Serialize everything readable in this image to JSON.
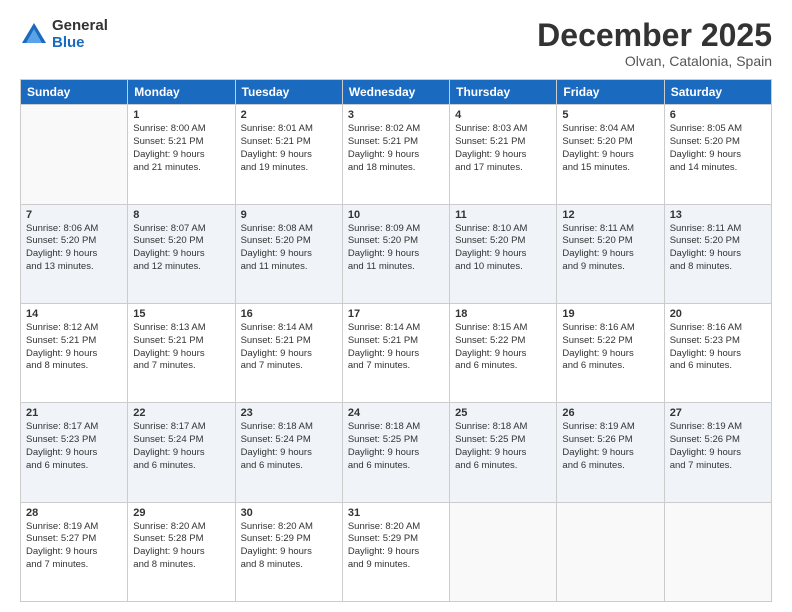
{
  "logo": {
    "general": "General",
    "blue": "Blue"
  },
  "title": "December 2025",
  "subtitle": "Olvan, Catalonia, Spain",
  "headers": [
    "Sunday",
    "Monday",
    "Tuesday",
    "Wednesday",
    "Thursday",
    "Friday",
    "Saturday"
  ],
  "weeks": [
    [
      {
        "day": "",
        "info": ""
      },
      {
        "day": "1",
        "info": "Sunrise: 8:00 AM\nSunset: 5:21 PM\nDaylight: 9 hours\nand 21 minutes."
      },
      {
        "day": "2",
        "info": "Sunrise: 8:01 AM\nSunset: 5:21 PM\nDaylight: 9 hours\nand 19 minutes."
      },
      {
        "day": "3",
        "info": "Sunrise: 8:02 AM\nSunset: 5:21 PM\nDaylight: 9 hours\nand 18 minutes."
      },
      {
        "day": "4",
        "info": "Sunrise: 8:03 AM\nSunset: 5:21 PM\nDaylight: 9 hours\nand 17 minutes."
      },
      {
        "day": "5",
        "info": "Sunrise: 8:04 AM\nSunset: 5:20 PM\nDaylight: 9 hours\nand 15 minutes."
      },
      {
        "day": "6",
        "info": "Sunrise: 8:05 AM\nSunset: 5:20 PM\nDaylight: 9 hours\nand 14 minutes."
      }
    ],
    [
      {
        "day": "7",
        "info": "Sunrise: 8:06 AM\nSunset: 5:20 PM\nDaylight: 9 hours\nand 13 minutes."
      },
      {
        "day": "8",
        "info": "Sunrise: 8:07 AM\nSunset: 5:20 PM\nDaylight: 9 hours\nand 12 minutes."
      },
      {
        "day": "9",
        "info": "Sunrise: 8:08 AM\nSunset: 5:20 PM\nDaylight: 9 hours\nand 11 minutes."
      },
      {
        "day": "10",
        "info": "Sunrise: 8:09 AM\nSunset: 5:20 PM\nDaylight: 9 hours\nand 11 minutes."
      },
      {
        "day": "11",
        "info": "Sunrise: 8:10 AM\nSunset: 5:20 PM\nDaylight: 9 hours\nand 10 minutes."
      },
      {
        "day": "12",
        "info": "Sunrise: 8:11 AM\nSunset: 5:20 PM\nDaylight: 9 hours\nand 9 minutes."
      },
      {
        "day": "13",
        "info": "Sunrise: 8:11 AM\nSunset: 5:20 PM\nDaylight: 9 hours\nand 8 minutes."
      }
    ],
    [
      {
        "day": "14",
        "info": "Sunrise: 8:12 AM\nSunset: 5:21 PM\nDaylight: 9 hours\nand 8 minutes."
      },
      {
        "day": "15",
        "info": "Sunrise: 8:13 AM\nSunset: 5:21 PM\nDaylight: 9 hours\nand 7 minutes."
      },
      {
        "day": "16",
        "info": "Sunrise: 8:14 AM\nSunset: 5:21 PM\nDaylight: 9 hours\nand 7 minutes."
      },
      {
        "day": "17",
        "info": "Sunrise: 8:14 AM\nSunset: 5:21 PM\nDaylight: 9 hours\nand 7 minutes."
      },
      {
        "day": "18",
        "info": "Sunrise: 8:15 AM\nSunset: 5:22 PM\nDaylight: 9 hours\nand 6 minutes."
      },
      {
        "day": "19",
        "info": "Sunrise: 8:16 AM\nSunset: 5:22 PM\nDaylight: 9 hours\nand 6 minutes."
      },
      {
        "day": "20",
        "info": "Sunrise: 8:16 AM\nSunset: 5:23 PM\nDaylight: 9 hours\nand 6 minutes."
      }
    ],
    [
      {
        "day": "21",
        "info": "Sunrise: 8:17 AM\nSunset: 5:23 PM\nDaylight: 9 hours\nand 6 minutes."
      },
      {
        "day": "22",
        "info": "Sunrise: 8:17 AM\nSunset: 5:24 PM\nDaylight: 9 hours\nand 6 minutes."
      },
      {
        "day": "23",
        "info": "Sunrise: 8:18 AM\nSunset: 5:24 PM\nDaylight: 9 hours\nand 6 minutes."
      },
      {
        "day": "24",
        "info": "Sunrise: 8:18 AM\nSunset: 5:25 PM\nDaylight: 9 hours\nand 6 minutes."
      },
      {
        "day": "25",
        "info": "Sunrise: 8:18 AM\nSunset: 5:25 PM\nDaylight: 9 hours\nand 6 minutes."
      },
      {
        "day": "26",
        "info": "Sunrise: 8:19 AM\nSunset: 5:26 PM\nDaylight: 9 hours\nand 6 minutes."
      },
      {
        "day": "27",
        "info": "Sunrise: 8:19 AM\nSunset: 5:26 PM\nDaylight: 9 hours\nand 7 minutes."
      }
    ],
    [
      {
        "day": "28",
        "info": "Sunrise: 8:19 AM\nSunset: 5:27 PM\nDaylight: 9 hours\nand 7 minutes."
      },
      {
        "day": "29",
        "info": "Sunrise: 8:20 AM\nSunset: 5:28 PM\nDaylight: 9 hours\nand 8 minutes."
      },
      {
        "day": "30",
        "info": "Sunrise: 8:20 AM\nSunset: 5:29 PM\nDaylight: 9 hours\nand 8 minutes."
      },
      {
        "day": "31",
        "info": "Sunrise: 8:20 AM\nSunset: 5:29 PM\nDaylight: 9 hours\nand 9 minutes."
      },
      {
        "day": "",
        "info": ""
      },
      {
        "day": "",
        "info": ""
      },
      {
        "day": "",
        "info": ""
      }
    ]
  ]
}
